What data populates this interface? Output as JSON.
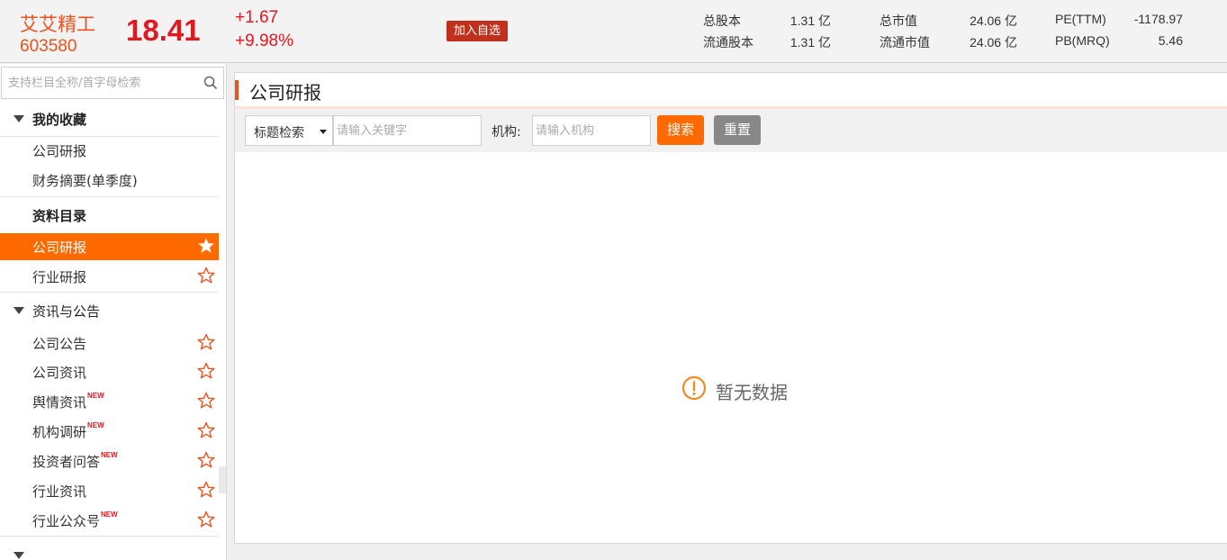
{
  "header": {
    "stock_name": "艾艾精工",
    "stock_code": "603580",
    "price": "18.41",
    "change": "+1.67",
    "change_pct": "+9.98%",
    "add_watchlist_label": "加入自选",
    "stats": {
      "total_shares_label": "总股本",
      "total_shares_value": "1.31 亿",
      "float_shares_label": "流通股本",
      "float_shares_value": "1.31 亿",
      "market_cap_label": "总市值",
      "market_cap_value": "24.06 亿",
      "float_market_cap_label": "流通市值",
      "float_market_cap_value": "24.06 亿",
      "pe_label": "PE(TTM)",
      "pe_value": "-1178.97",
      "pb_label": "PB(MRQ)",
      "pb_value": "5.46"
    }
  },
  "sidebar": {
    "search_placeholder": "支持栏目全称/首字母检索",
    "favorites": {
      "title": "我的收藏",
      "items": [
        "公司研报",
        "财务摘要(单季度)"
      ]
    },
    "catalog": {
      "title": "资料目录",
      "items": [
        {
          "label": "公司研报",
          "active": true
        },
        {
          "label": "行业研报",
          "active": false
        }
      ]
    },
    "news": {
      "title": "资讯与公告",
      "items": [
        {
          "label": "公司公告",
          "badge": ""
        },
        {
          "label": "公司资讯",
          "badge": ""
        },
        {
          "label": "舆情资讯",
          "badge": "NEW"
        },
        {
          "label": "机构调研",
          "badge": "NEW"
        },
        {
          "label": "投资者问答",
          "badge": "NEW"
        },
        {
          "label": "行业资讯",
          "badge": ""
        },
        {
          "label": "行业公众号",
          "badge": "NEW"
        }
      ]
    }
  },
  "main": {
    "title": "公司研报",
    "filter": {
      "select_value": "标题检索",
      "keyword_placeholder": "请输入关键字",
      "org_label": "机构:",
      "org_placeholder": "请输入机构",
      "search_label": "搜索",
      "reset_label": "重置"
    },
    "empty_text": "暂无数据"
  },
  "colors": {
    "accent": "#ff6a00",
    "price_red": "#e0181f",
    "name_orange": "#e8531f"
  }
}
